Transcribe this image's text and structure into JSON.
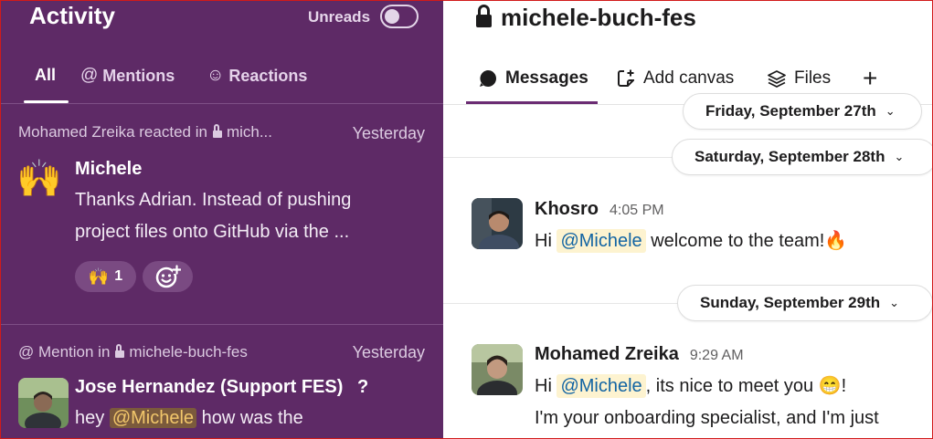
{
  "activity": {
    "title": "Activity",
    "unreads_label": "Unreads",
    "tabs": [
      {
        "label": "All",
        "icon": ""
      },
      {
        "label": "Mentions",
        "icon": "@"
      },
      {
        "label": "Reactions",
        "icon": "☺"
      }
    ],
    "items": [
      {
        "meta_prefix": "Mohamed Zreika reacted in",
        "channel": "mich...",
        "time": "Yesterday",
        "emoji": "🙌",
        "sender": "Michele",
        "preview_line1": "Thanks Adrian. Instead of pushing",
        "preview_line2": "project files onto GitHub via the ...",
        "reaction_emoji": "🙌",
        "reaction_count": "1",
        "add_reaction_icon": "add-reaction-icon"
      },
      {
        "meta_prefix": "@ Mention in",
        "channel": "michele-buch-fes",
        "time": "Yesterday",
        "sender": "Jose Hernandez (Support FES)",
        "sender_suffix": "?",
        "preview_before": "hey ",
        "preview_mention": "@Michele",
        "preview_after": " how was the"
      }
    ]
  },
  "channel": {
    "name": "michele-buch-fes",
    "tabs": [
      {
        "label": "Messages",
        "icon": "messages-icon"
      },
      {
        "label": "Add canvas",
        "icon": "canvas-icon"
      },
      {
        "label": "Files",
        "icon": "files-icon"
      },
      {
        "label": "+",
        "icon": "plus-icon"
      }
    ],
    "dates": [
      "Friday, September 27th",
      "Saturday, September 28th",
      "Sunday, September 29th"
    ],
    "messages": [
      {
        "author": "Khosro",
        "time": "4:05 PM",
        "text_before": "Hi ",
        "mention": "@Michele",
        "text_after": " welcome to the team!",
        "emoji": "🔥"
      },
      {
        "author": "Mohamed Zreika",
        "time": "9:29 AM",
        "text_before": "Hi ",
        "mention": "@Michele",
        "text_after": ", its nice to meet you ",
        "emoji": "😁",
        "text_end": "!",
        "line2": "I'm your onboarding specialist, and I'm just"
      }
    ]
  },
  "colors": {
    "sidebar_bg": "#5e2a66",
    "accent": "#6b2c73",
    "mention_bg": "#fdf3d0",
    "mention_text": "#1264a3"
  }
}
